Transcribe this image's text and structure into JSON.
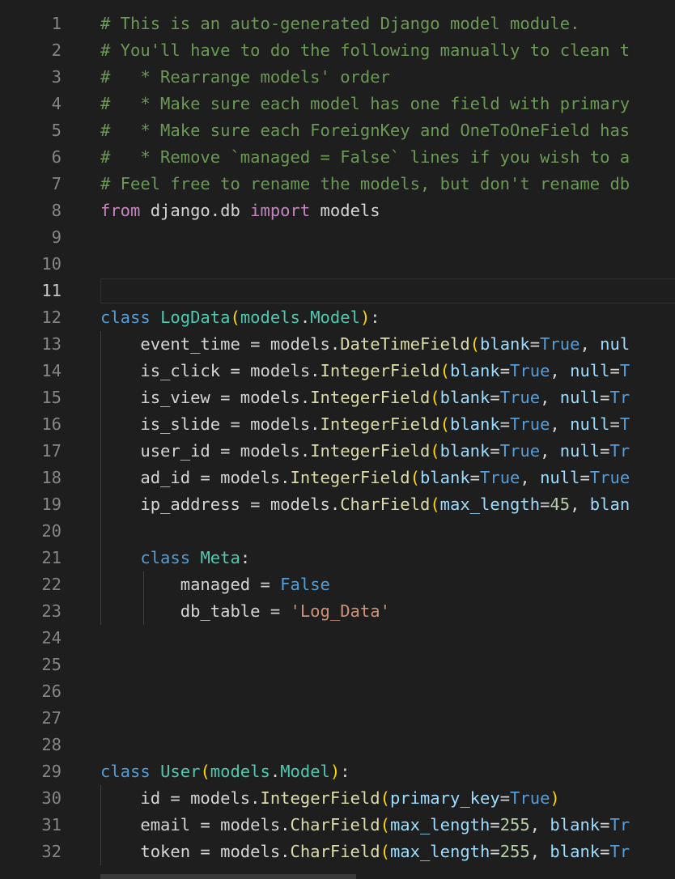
{
  "editor": {
    "current_line": 11,
    "lines": [
      {
        "n": "1",
        "indent": 0,
        "tokens": [
          {
            "t": "# This is an auto-generated Django model module.",
            "c": "comment"
          }
        ]
      },
      {
        "n": "2",
        "indent": 0,
        "tokens": [
          {
            "t": "# You'll have to do the following manually to clean t",
            "c": "comment"
          }
        ]
      },
      {
        "n": "3",
        "indent": 0,
        "tokens": [
          {
            "t": "#   * Rearrange models' order",
            "c": "comment"
          }
        ]
      },
      {
        "n": "4",
        "indent": 0,
        "tokens": [
          {
            "t": "#   * Make sure each model has one field with primary",
            "c": "comment"
          }
        ]
      },
      {
        "n": "5",
        "indent": 0,
        "tokens": [
          {
            "t": "#   * Make sure each ForeignKey and OneToOneField has",
            "c": "comment"
          }
        ]
      },
      {
        "n": "6",
        "indent": 0,
        "tokens": [
          {
            "t": "#   * Remove `managed = False` lines if you wish to a",
            "c": "comment"
          }
        ]
      },
      {
        "n": "7",
        "indent": 0,
        "tokens": [
          {
            "t": "# Feel free to rename the models, but don't rename db",
            "c": "comment"
          }
        ]
      },
      {
        "n": "8",
        "indent": 0,
        "tokens": [
          {
            "t": "from",
            "c": "keyword"
          },
          {
            "t": " django.db ",
            "c": "text"
          },
          {
            "t": "import",
            "c": "keyword"
          },
          {
            "t": " models",
            "c": "text"
          }
        ]
      },
      {
        "n": "9",
        "indent": 0,
        "tokens": []
      },
      {
        "n": "10",
        "indent": 0,
        "tokens": []
      },
      {
        "n": "11",
        "indent": 0,
        "tokens": []
      },
      {
        "n": "12",
        "indent": 0,
        "tokens": [
          {
            "t": "class",
            "c": "storage"
          },
          {
            "t": " ",
            "c": "text"
          },
          {
            "t": "LogData",
            "c": "class"
          },
          {
            "t": "(",
            "c": "paren1"
          },
          {
            "t": "models",
            "c": "class"
          },
          {
            "t": ".",
            "c": "text"
          },
          {
            "t": "Model",
            "c": "class"
          },
          {
            "t": ")",
            "c": "paren1"
          },
          {
            "t": ":",
            "c": "text"
          }
        ]
      },
      {
        "n": "13",
        "indent": 1,
        "tokens": [
          {
            "t": "    event_time = models.",
            "c": "text"
          },
          {
            "t": "DateTimeField",
            "c": "func"
          },
          {
            "t": "(",
            "c": "paren1"
          },
          {
            "t": "blank",
            "c": "ident"
          },
          {
            "t": "=",
            "c": "text"
          },
          {
            "t": "True",
            "c": "bool"
          },
          {
            "t": ", ",
            "c": "text"
          },
          {
            "t": "nul",
            "c": "ident"
          }
        ]
      },
      {
        "n": "14",
        "indent": 1,
        "tokens": [
          {
            "t": "    is_click = models.",
            "c": "text"
          },
          {
            "t": "IntegerField",
            "c": "func"
          },
          {
            "t": "(",
            "c": "paren1"
          },
          {
            "t": "blank",
            "c": "ident"
          },
          {
            "t": "=",
            "c": "text"
          },
          {
            "t": "True",
            "c": "bool"
          },
          {
            "t": ", ",
            "c": "text"
          },
          {
            "t": "null",
            "c": "ident"
          },
          {
            "t": "=",
            "c": "text"
          },
          {
            "t": "T",
            "c": "bool"
          }
        ]
      },
      {
        "n": "15",
        "indent": 1,
        "tokens": [
          {
            "t": "    is_view = models.",
            "c": "text"
          },
          {
            "t": "IntegerField",
            "c": "func"
          },
          {
            "t": "(",
            "c": "paren1"
          },
          {
            "t": "blank",
            "c": "ident"
          },
          {
            "t": "=",
            "c": "text"
          },
          {
            "t": "True",
            "c": "bool"
          },
          {
            "t": ", ",
            "c": "text"
          },
          {
            "t": "null",
            "c": "ident"
          },
          {
            "t": "=",
            "c": "text"
          },
          {
            "t": "Tr",
            "c": "bool"
          }
        ]
      },
      {
        "n": "16",
        "indent": 1,
        "tokens": [
          {
            "t": "    is_slide = models.",
            "c": "text"
          },
          {
            "t": "IntegerField",
            "c": "func"
          },
          {
            "t": "(",
            "c": "paren1"
          },
          {
            "t": "blank",
            "c": "ident"
          },
          {
            "t": "=",
            "c": "text"
          },
          {
            "t": "True",
            "c": "bool"
          },
          {
            "t": ", ",
            "c": "text"
          },
          {
            "t": "null",
            "c": "ident"
          },
          {
            "t": "=",
            "c": "text"
          },
          {
            "t": "T",
            "c": "bool"
          }
        ]
      },
      {
        "n": "17",
        "indent": 1,
        "tokens": [
          {
            "t": "    user_id = models.",
            "c": "text"
          },
          {
            "t": "IntegerField",
            "c": "func"
          },
          {
            "t": "(",
            "c": "paren1"
          },
          {
            "t": "blank",
            "c": "ident"
          },
          {
            "t": "=",
            "c": "text"
          },
          {
            "t": "True",
            "c": "bool"
          },
          {
            "t": ", ",
            "c": "text"
          },
          {
            "t": "null",
            "c": "ident"
          },
          {
            "t": "=",
            "c": "text"
          },
          {
            "t": "Tr",
            "c": "bool"
          }
        ]
      },
      {
        "n": "18",
        "indent": 1,
        "tokens": [
          {
            "t": "    ad_id = models.",
            "c": "text"
          },
          {
            "t": "IntegerField",
            "c": "func"
          },
          {
            "t": "(",
            "c": "paren1"
          },
          {
            "t": "blank",
            "c": "ident"
          },
          {
            "t": "=",
            "c": "text"
          },
          {
            "t": "True",
            "c": "bool"
          },
          {
            "t": ", ",
            "c": "text"
          },
          {
            "t": "null",
            "c": "ident"
          },
          {
            "t": "=",
            "c": "text"
          },
          {
            "t": "True",
            "c": "bool"
          }
        ]
      },
      {
        "n": "19",
        "indent": 1,
        "tokens": [
          {
            "t": "    ip_address = models.",
            "c": "text"
          },
          {
            "t": "CharField",
            "c": "func"
          },
          {
            "t": "(",
            "c": "paren1"
          },
          {
            "t": "max_length",
            "c": "ident"
          },
          {
            "t": "=",
            "c": "text"
          },
          {
            "t": "45",
            "c": "number"
          },
          {
            "t": ", ",
            "c": "text"
          },
          {
            "t": "blan",
            "c": "ident"
          }
        ]
      },
      {
        "n": "20",
        "indent": 1,
        "tokens": []
      },
      {
        "n": "21",
        "indent": 1,
        "tokens": [
          {
            "t": "    ",
            "c": "text"
          },
          {
            "t": "class",
            "c": "storage"
          },
          {
            "t": " ",
            "c": "text"
          },
          {
            "t": "Meta",
            "c": "class"
          },
          {
            "t": ":",
            "c": "text"
          }
        ]
      },
      {
        "n": "22",
        "indent": 2,
        "tokens": [
          {
            "t": "        managed = ",
            "c": "text"
          },
          {
            "t": "False",
            "c": "bool"
          }
        ]
      },
      {
        "n": "23",
        "indent": 2,
        "tokens": [
          {
            "t": "        db_table = ",
            "c": "text"
          },
          {
            "t": "'Log_Data'",
            "c": "string"
          }
        ]
      },
      {
        "n": "24",
        "indent": 0,
        "tokens": []
      },
      {
        "n": "25",
        "indent": 0,
        "tokens": []
      },
      {
        "n": "26",
        "indent": 0,
        "tokens": []
      },
      {
        "n": "27",
        "indent": 0,
        "tokens": []
      },
      {
        "n": "28",
        "indent": 0,
        "tokens": []
      },
      {
        "n": "29",
        "indent": 0,
        "tokens": [
          {
            "t": "class",
            "c": "storage"
          },
          {
            "t": " ",
            "c": "text"
          },
          {
            "t": "User",
            "c": "class"
          },
          {
            "t": "(",
            "c": "paren1"
          },
          {
            "t": "models",
            "c": "class"
          },
          {
            "t": ".",
            "c": "text"
          },
          {
            "t": "Model",
            "c": "class"
          },
          {
            "t": ")",
            "c": "paren1"
          },
          {
            "t": ":",
            "c": "text"
          }
        ]
      },
      {
        "n": "30",
        "indent": 1,
        "tokens": [
          {
            "t": "    id = models.",
            "c": "text"
          },
          {
            "t": "IntegerField",
            "c": "func"
          },
          {
            "t": "(",
            "c": "paren1"
          },
          {
            "t": "primary_key",
            "c": "ident"
          },
          {
            "t": "=",
            "c": "text"
          },
          {
            "t": "True",
            "c": "bool"
          },
          {
            "t": ")",
            "c": "paren1"
          }
        ]
      },
      {
        "n": "31",
        "indent": 1,
        "tokens": [
          {
            "t": "    email = models.",
            "c": "text"
          },
          {
            "t": "CharField",
            "c": "func"
          },
          {
            "t": "(",
            "c": "paren1"
          },
          {
            "t": "max_length",
            "c": "ident"
          },
          {
            "t": "=",
            "c": "text"
          },
          {
            "t": "255",
            "c": "number"
          },
          {
            "t": ", ",
            "c": "text"
          },
          {
            "t": "blank",
            "c": "ident"
          },
          {
            "t": "=",
            "c": "text"
          },
          {
            "t": "Tr",
            "c": "bool"
          }
        ]
      },
      {
        "n": "32",
        "indent": 1,
        "tokens": [
          {
            "t": "    token = models.",
            "c": "text"
          },
          {
            "t": "CharField",
            "c": "func"
          },
          {
            "t": "(",
            "c": "paren1"
          },
          {
            "t": "max_length",
            "c": "ident"
          },
          {
            "t": "=",
            "c": "text"
          },
          {
            "t": "255",
            "c": "number"
          },
          {
            "t": ", ",
            "c": "text"
          },
          {
            "t": "blank",
            "c": "ident"
          },
          {
            "t": "=",
            "c": "text"
          },
          {
            "t": "Tr",
            "c": "bool"
          }
        ]
      }
    ]
  }
}
